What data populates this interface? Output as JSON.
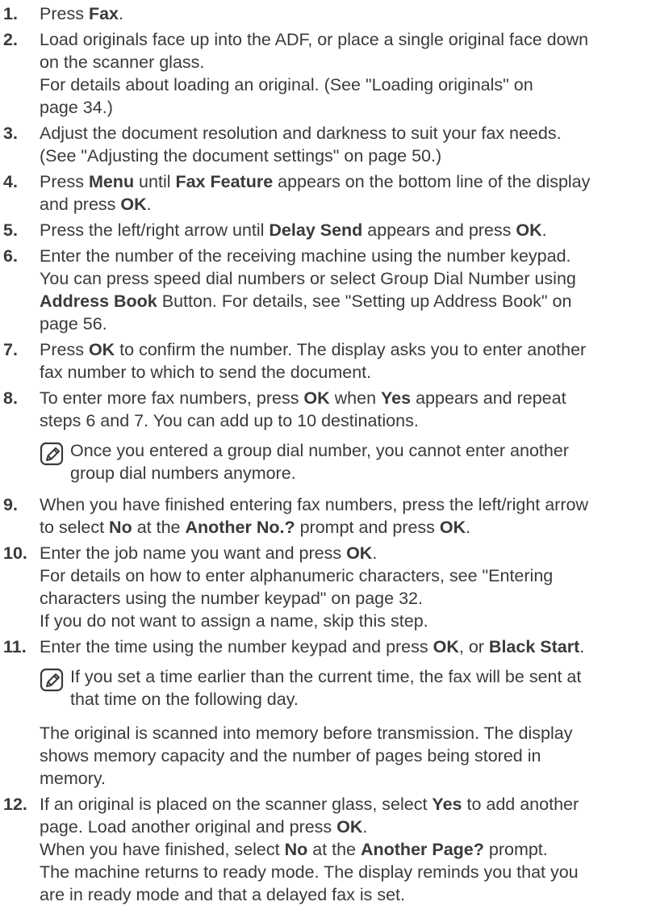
{
  "steps": [
    {
      "num": "1.",
      "lines": [
        [
          {
            "t": "Press "
          },
          {
            "t": "Fax",
            "b": true
          },
          {
            "t": "."
          }
        ]
      ]
    },
    {
      "num": "2.",
      "lines": [
        [
          {
            "t": "Load originals face up into the ADF, or place a single original face down"
          }
        ],
        [
          {
            "t": "on the scanner glass."
          }
        ],
        [
          {
            "t": "For details about loading an original. (See \"Loading originals\" on"
          }
        ],
        [
          {
            "t": "page 34.)"
          }
        ]
      ]
    },
    {
      "num": "3.",
      "lines": [
        [
          {
            "t": "Adjust the document resolution and darkness to suit your fax needs."
          }
        ],
        [
          {
            "t": "(See \"Adjusting the document settings\" on page 50.)"
          }
        ]
      ]
    },
    {
      "num": "4.",
      "lines": [
        [
          {
            "t": "Press "
          },
          {
            "t": "Menu",
            "b": true
          },
          {
            "t": " until "
          },
          {
            "t": "Fax Feature",
            "b": true
          },
          {
            "t": " appears on the bottom line of the display"
          }
        ],
        [
          {
            "t": "and press "
          },
          {
            "t": "OK",
            "b": true
          },
          {
            "t": "."
          }
        ]
      ]
    },
    {
      "num": "5.",
      "lines": [
        [
          {
            "t": "Press the left/right arrow until "
          },
          {
            "t": "Delay Send",
            "b": true
          },
          {
            "t": " appears and press "
          },
          {
            "t": "OK",
            "b": true
          },
          {
            "t": "."
          }
        ]
      ]
    },
    {
      "num": "6.",
      "lines": [
        [
          {
            "t": "Enter the number of the receiving machine using the number keypad."
          }
        ],
        [
          {
            "t": "You can press speed dial numbers or select Group Dial Number using"
          }
        ],
        [
          {
            "t": "Address Book",
            "b": true
          },
          {
            "t": " Button. For details, see \"Setting up Address Book\" on"
          }
        ],
        [
          {
            "t": "page 56."
          }
        ]
      ]
    },
    {
      "num": "7.",
      "lines": [
        [
          {
            "t": "Press "
          },
          {
            "t": "OK",
            "b": true
          },
          {
            "t": " to confirm the number. The display asks you to enter another"
          }
        ],
        [
          {
            "t": "fax number to which to send the document."
          }
        ]
      ]
    },
    {
      "num": "8.",
      "lines": [
        [
          {
            "t": "To enter more fax numbers, press "
          },
          {
            "t": "OK",
            "b": true
          },
          {
            "t": " when "
          },
          {
            "t": "Yes",
            "b": true
          },
          {
            "t": " appears and repeat"
          }
        ],
        [
          {
            "t": "steps 6 and 7. You can add up to 10 destinations."
          }
        ]
      ],
      "note": {
        "icon": "note-pencil-icon",
        "lines": [
          "Once you entered a group dial number, you cannot enter another",
          "group dial numbers anymore."
        ]
      }
    },
    {
      "num": "9.",
      "lines": [
        [
          {
            "t": "When you have finished entering fax numbers, press the left/right arrow"
          }
        ],
        [
          {
            "t": "to select "
          },
          {
            "t": "No",
            "b": true
          },
          {
            "t": " at the "
          },
          {
            "t": "Another No.?",
            "b": true
          },
          {
            "t": " prompt and press "
          },
          {
            "t": "OK",
            "b": true
          },
          {
            "t": "."
          }
        ]
      ]
    },
    {
      "num": "10.",
      "lines": [
        [
          {
            "t": "Enter the job name you want and press "
          },
          {
            "t": "OK",
            "b": true
          },
          {
            "t": "."
          }
        ],
        [
          {
            "t": "For details on how to enter alphanumeric characters, see \"Entering"
          }
        ],
        [
          {
            "t": "characters using the number keypad\" on page 32."
          }
        ],
        [
          {
            "t": "If you do not want to assign a name, skip this step."
          }
        ]
      ]
    },
    {
      "num": "11.",
      "lines": [
        [
          {
            "t": "Enter the time using the number keypad and press "
          },
          {
            "t": "OK",
            "b": true
          },
          {
            "t": ", or "
          },
          {
            "t": "Black Start",
            "b": true
          },
          {
            "t": "."
          }
        ]
      ],
      "note": {
        "icon": "note-pencil-icon",
        "lines": [
          "If you set a time earlier than the current time, the fax will be sent at",
          "that time on the following day."
        ]
      },
      "after": [
        "The original is scanned into memory before transmission. The display",
        "shows memory capacity and the number of pages being stored in",
        "memory."
      ]
    },
    {
      "num": "12.",
      "lines": [
        [
          {
            "t": "If an original is placed on the scanner glass, select "
          },
          {
            "t": "Yes",
            "b": true
          },
          {
            "t": " to add another"
          }
        ],
        [
          {
            "t": "page. Load another original and press "
          },
          {
            "t": "OK",
            "b": true
          },
          {
            "t": "."
          }
        ],
        [
          {
            "t": "When you have finished, select "
          },
          {
            "t": "No",
            "b": true
          },
          {
            "t": " at the "
          },
          {
            "t": "Another Page?",
            "b": true
          },
          {
            "t": " prompt."
          }
        ],
        [
          {
            "t": "The machine returns to ready mode. The display reminds you that you"
          }
        ],
        [
          {
            "t": "are in ready mode and that a delayed fax is set."
          }
        ]
      ]
    }
  ]
}
